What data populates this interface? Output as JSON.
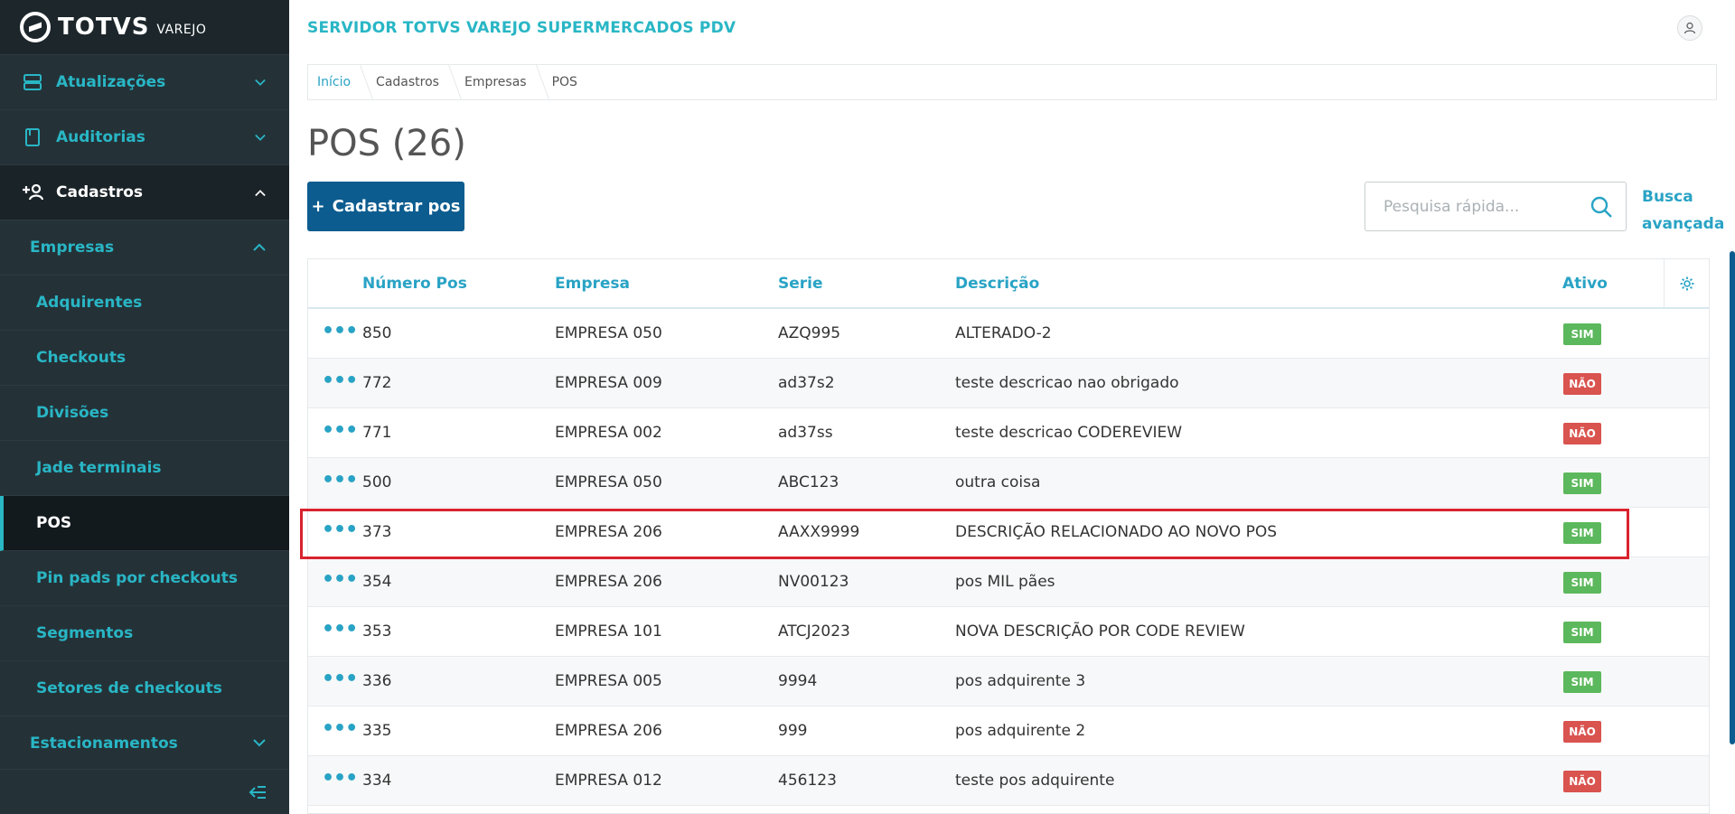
{
  "logo": {
    "brand": "TOTVS",
    "sub": "VAREJO"
  },
  "sidebar": {
    "items": [
      {
        "label": "Atualizações",
        "icon": "server-icon"
      },
      {
        "label": "Auditorias",
        "icon": "book-icon"
      },
      {
        "label": "Cadastros",
        "icon": "add-user-icon"
      }
    ],
    "sub": {
      "label": "Empresas"
    },
    "leaves": [
      "Adquirentes",
      "Checkouts",
      "Divisões",
      "Jade terminais",
      "POS",
      "Pin pads por checkouts",
      "Segmentos",
      "Setores de checkouts"
    ],
    "sub2": {
      "label": "Estacionamentos"
    }
  },
  "header": {
    "title": "SERVIDOR TOTVS VAREJO SUPERMERCADOS PDV"
  },
  "breadcrumb": [
    "Início",
    "Cadastros",
    "Empresas",
    "POS"
  ],
  "page": {
    "title": "POS (26)",
    "add_button": "Cadastrar pos",
    "search_placeholder": "Pesquisa rápida...",
    "adv_search_line1": "Busca",
    "adv_search_line2": "avançada"
  },
  "table": {
    "columns": [
      "Número Pos",
      "Empresa",
      "Serie",
      "Descrição",
      "Ativo"
    ],
    "rows": [
      {
        "numero": "850",
        "empresa": "EMPRESA 050",
        "serie": "AZQ995",
        "descricao": "ALTERADO-2",
        "ativo": "SIM"
      },
      {
        "numero": "772",
        "empresa": "EMPRESA 009",
        "serie": "ad37s2",
        "descricao": "teste descricao nao obrigado",
        "ativo": "NÃO"
      },
      {
        "numero": "771",
        "empresa": "EMPRESA 002",
        "serie": "ad37ss",
        "descricao": "teste descricao CODEREVIEW",
        "ativo": "NÃO"
      },
      {
        "numero": "500",
        "empresa": "EMPRESA 050",
        "serie": "ABC123",
        "descricao": "outra coisa",
        "ativo": "SIM"
      },
      {
        "numero": "373",
        "empresa": "EMPRESA 206",
        "serie": "AAXX9999",
        "descricao": "DESCRIÇÃO RELACIONADO AO NOVO POS",
        "ativo": "SIM"
      },
      {
        "numero": "354",
        "empresa": "EMPRESA 206",
        "serie": "NV00123",
        "descricao": "pos MIL pães",
        "ativo": "SIM"
      },
      {
        "numero": "353",
        "empresa": "EMPRESA 101",
        "serie": "ATCJ2023",
        "descricao": "NOVA DESCRIÇÃO POR CODE REVIEW",
        "ativo": "SIM"
      },
      {
        "numero": "336",
        "empresa": "EMPRESA 005",
        "serie": "9994",
        "descricao": "pos adquirente 3",
        "ativo": "SIM"
      },
      {
        "numero": "335",
        "empresa": "EMPRESA 206",
        "serie": "999",
        "descricao": "pos adquirente 2",
        "ativo": "NÃO"
      },
      {
        "numero": "334",
        "empresa": "EMPRESA 012",
        "serie": "456123",
        "descricao": "teste pos adquirente",
        "ativo": "NÃO"
      }
    ]
  },
  "colors": {
    "accent": "#29b6c5",
    "primary": "#0c5c8f",
    "sidebar": "#243238",
    "sim": "#5cb85c",
    "nao": "#d9534f",
    "highlight": "#d9232e"
  }
}
